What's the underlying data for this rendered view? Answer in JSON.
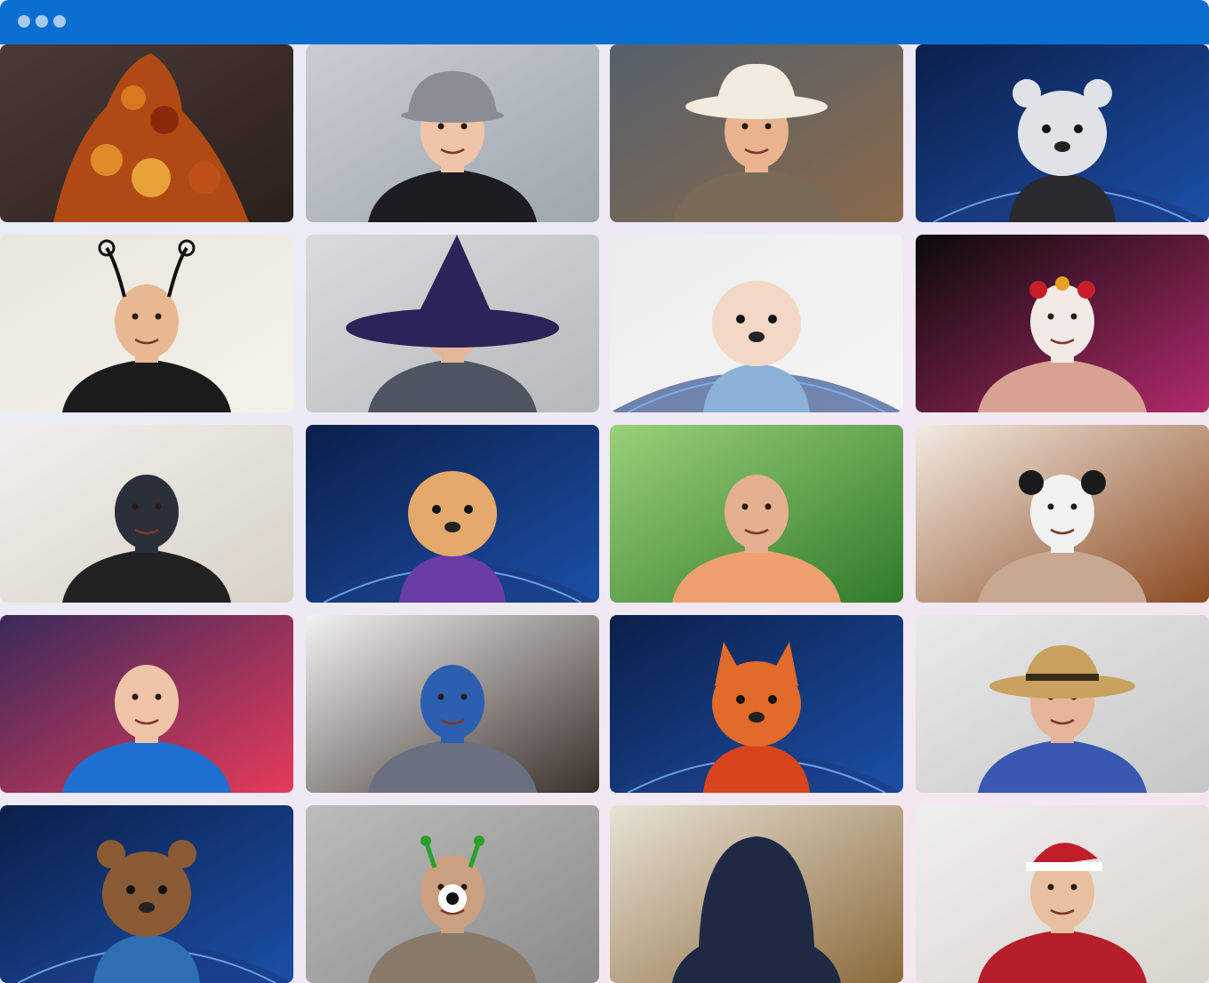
{
  "window": {
    "menu_icon": "more-horizontal-icon",
    "accent": "#0a6ed1"
  },
  "participants": [
    {
      "costume": "autumn-leaves",
      "bg": "#4a3a36",
      "bg2": "#2b201c",
      "skin": "#c98a58",
      "body": "#b04a14",
      "bodyShape": "leaves",
      "hat": "none",
      "hatColor": "#000000"
    },
    {
      "costume": "detective",
      "bg": "#c8cdd2",
      "bg2": "#9ea6ae",
      "skin": "#f0c4a8",
      "body": "#1c1c22",
      "bodyShape": "person",
      "hat": "cap",
      "hatColor": "#8a8e94"
    },
    {
      "costume": "cowboy",
      "bg": "#55606c",
      "bg2": "#8a6a4a",
      "skin": "#e9b38f",
      "body": "#7a6a58",
      "bodyShape": "person",
      "hat": "cowboy",
      "hatColor": "#f2ece0"
    },
    {
      "costume": "polar-bear-avatar",
      "bg": "#0b1f4a",
      "bg2": "#1b4fa6",
      "skin": "#dfe3e8",
      "body": "#2a2a2e",
      "bodyShape": "avatar",
      "hat": "bear-ears",
      "hatColor": "#dfe3e8"
    },
    {
      "costume": "butterfly",
      "bg": "#e8e6de",
      "bg2": "#f6f2ea",
      "skin": "#e8b893",
      "body": "#1b1b1b",
      "bodyShape": "person",
      "hat": "antennae",
      "hatColor": "#111111"
    },
    {
      "costume": "witch",
      "bg": "#d8dbdc",
      "bg2": "#b6b9bb",
      "skin": "#e3b79a",
      "body": "#4e5560",
      "bodyShape": "person",
      "hat": "witch",
      "hatColor": "#2b2458"
    },
    {
      "costume": "cartoon-avatar",
      "bg": "#ececec",
      "bg2": "#f5f5f5",
      "skin": "#f3d8c6",
      "body": "#8ab2d6",
      "bodyShape": "avatar",
      "hat": "none",
      "hatColor": "#000000"
    },
    {
      "costume": "sugar-skull",
      "bg": "#0a0a0a",
      "bg2": "#b02a6a",
      "skin": "#f2eae6",
      "body": "#d7a292",
      "bodyShape": "person",
      "hat": "flowers",
      "hatColor": "#c81e2a"
    },
    {
      "costume": "neon-skull-mask",
      "bg": "#f0efec",
      "bg2": "#d8d2c6",
      "skin": "#2a2f3a",
      "body": "#222222",
      "bodyShape": "person",
      "hat": "none",
      "hatColor": "#000000"
    },
    {
      "costume": "cow-avatar",
      "bg": "#0b1f4a",
      "bg2": "#1b4fa6",
      "skin": "#e3a86a",
      "body": "#6a3ca6",
      "bodyShape": "avatar",
      "hat": "none",
      "hatColor": "#000000"
    },
    {
      "costume": "dragon-background",
      "bg": "#9ad07a",
      "bg2": "#2f7a2a",
      "skin": "#e3b090",
      "body": "#f0a070",
      "bodyShape": "person",
      "hat": "none",
      "hatColor": "#000000"
    },
    {
      "costume": "panda-mask",
      "bg": "#f3ebe2",
      "bg2": "#8a4a20",
      "skin": "#f1f1f1",
      "body": "#c8a890",
      "bodyShape": "person",
      "hat": "panda-ears",
      "hatColor": "#1a1a1a"
    },
    {
      "costume": "monsters-background",
      "bg": "#3a2a5a",
      "bg2": "#e63a5a",
      "skin": "#f0c4a8",
      "body": "#1e6fd0",
      "bodyShape": "person",
      "hat": "none",
      "hatColor": "#000000"
    },
    {
      "costume": "luchador-mask",
      "bg": "#f2f2f2",
      "bg2": "#3a2f2a",
      "skin": "#2d5fb0",
      "body": "#6a7080",
      "bodyShape": "person",
      "hat": "none",
      "hatColor": "#000000"
    },
    {
      "costume": "fox-avatar",
      "bg": "#0b1f4a",
      "bg2": "#1b4fa6",
      "skin": "#e26a2a",
      "body": "#d8441c",
      "bodyShape": "avatar",
      "hat": "fox-ears",
      "hatColor": "#e26a2a"
    },
    {
      "costume": "straw-hat",
      "bg": "#e9e9e9",
      "bg2": "#c6c6c6",
      "skin": "#e6b598",
      "body": "#3a58b0",
      "bodyShape": "person",
      "hat": "straw",
      "hatColor": "#c8a25e"
    },
    {
      "costume": "bear-avatar",
      "bg": "#0b1f4a",
      "bg2": "#1b4fa6",
      "skin": "#8a5a34",
      "body": "#2e6fb0",
      "bodyShape": "avatar",
      "hat": "bear-ears",
      "hatColor": "#8a5a34"
    },
    {
      "costume": "cyclops-antennae",
      "bg": "#bcbcbc",
      "bg2": "#8a8a8a",
      "skin": "#caa081",
      "body": "#8a7a6a",
      "bodyShape": "person",
      "hat": "eye-antennae",
      "hatColor": "#2aa02a"
    },
    {
      "costume": "hood-sunglasses",
      "bg": "#e8e2d6",
      "bg2": "#8a6a3a",
      "skin": "#d8ad8e",
      "body": "#1e2a44",
      "bodyShape": "person",
      "hat": "hood",
      "hatColor": "#1e2a44"
    },
    {
      "costume": "santa",
      "bg": "#efefef",
      "bg2": "#d8d4cc",
      "skin": "#e8c0a0",
      "body": "#b51e2a",
      "bodyShape": "person",
      "hat": "santa",
      "hatColor": "#c21e2a"
    }
  ]
}
